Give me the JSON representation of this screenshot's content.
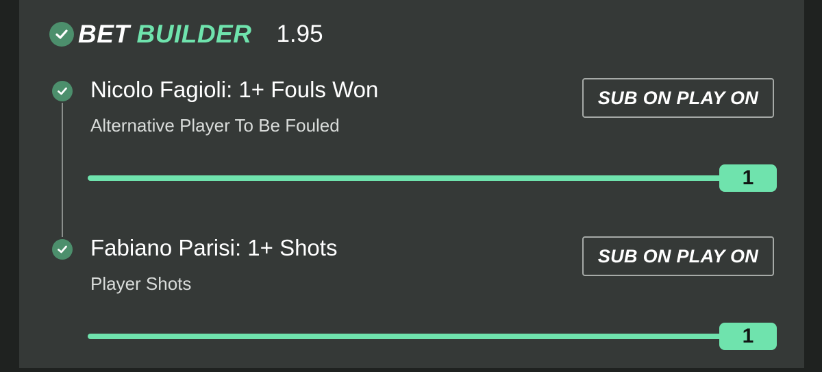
{
  "header": {
    "icon": "check-circle-icon",
    "brand_word_1": "BET",
    "brand_word_2": "BUILDER",
    "odds": "1.95"
  },
  "selections": [
    {
      "title": "Nicolo Fagioli: 1+ Fouls Won",
      "subtitle": "Alternative Player To Be Fouled",
      "sub_button_label": "SUB ON PLAY ON",
      "slider_value": "1",
      "slider_fill_fraction": 1.0
    },
    {
      "title": "Fabiano Parisi: 1+ Shots",
      "subtitle": "Player Shots",
      "sub_button_label": "SUB ON PLAY ON",
      "slider_value": "1",
      "slider_fill_fraction": 1.0
    }
  ],
  "colors": {
    "accent": "#6fe3ad",
    "check_green": "#4c8f6c",
    "card_background": "#353937"
  }
}
